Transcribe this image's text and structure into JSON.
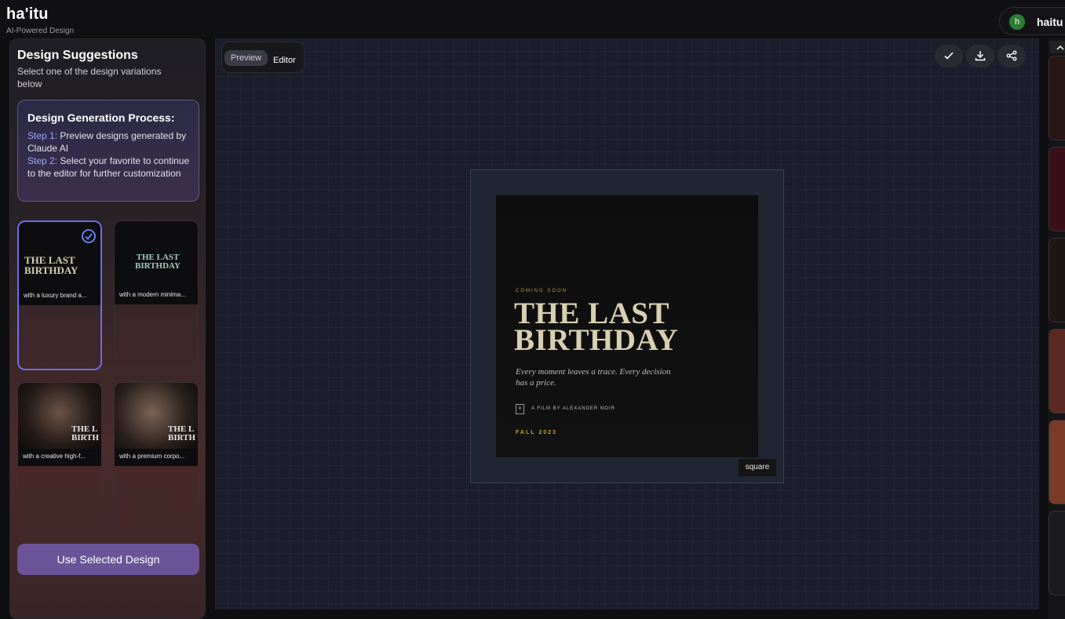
{
  "app": {
    "name": "ha'itu",
    "tagline": "AI-Powered Design",
    "user": {
      "initial": "h",
      "name": "haitu"
    }
  },
  "sidebar": {
    "title": "Design Suggestions",
    "subtitle": "Select one of the design variations below",
    "process": {
      "heading": "Design Generation Process:",
      "step1_label": "Step 1:",
      "step1_text": "Preview designs generated by Claude AI",
      "step2_label": "Step 2:",
      "step2_text": "Select your favorite to continue to the editor for further customization"
    },
    "cards": [
      {
        "caption": "with a luxury brand a...",
        "title_lines": "THE LAST BIRTHDAY",
        "selected": true
      },
      {
        "caption": "with a modern minima...",
        "title_lines": "THE LAST BIRTHDAY",
        "selected": false
      },
      {
        "caption": "with a creative high-f...",
        "title_lines": "THE L BIRTH",
        "selected": false
      },
      {
        "caption": "with a premium corpo...",
        "title_lines": "THE L BIRTH",
        "selected": false
      }
    ],
    "use_button": "Use Selected Design"
  },
  "toolbar": {
    "preview": "Preview",
    "editor": "Editor",
    "icons": [
      "check-icon",
      "download-icon",
      "share-icon"
    ]
  },
  "poster": {
    "coming": "COMING SOON",
    "title_line1": "THE LAST",
    "title_line2": "BIRTHDAY",
    "tagline": "Every moment leaves a trace. Every decision has a price.",
    "rating": "R",
    "credit": "A FILM BY ALEXANDER NOIR",
    "date": "FALL 2023",
    "format": "square"
  },
  "colors": {
    "accent": "#6b6cf0",
    "gold": "#c9a430",
    "button": "#6a5497"
  }
}
